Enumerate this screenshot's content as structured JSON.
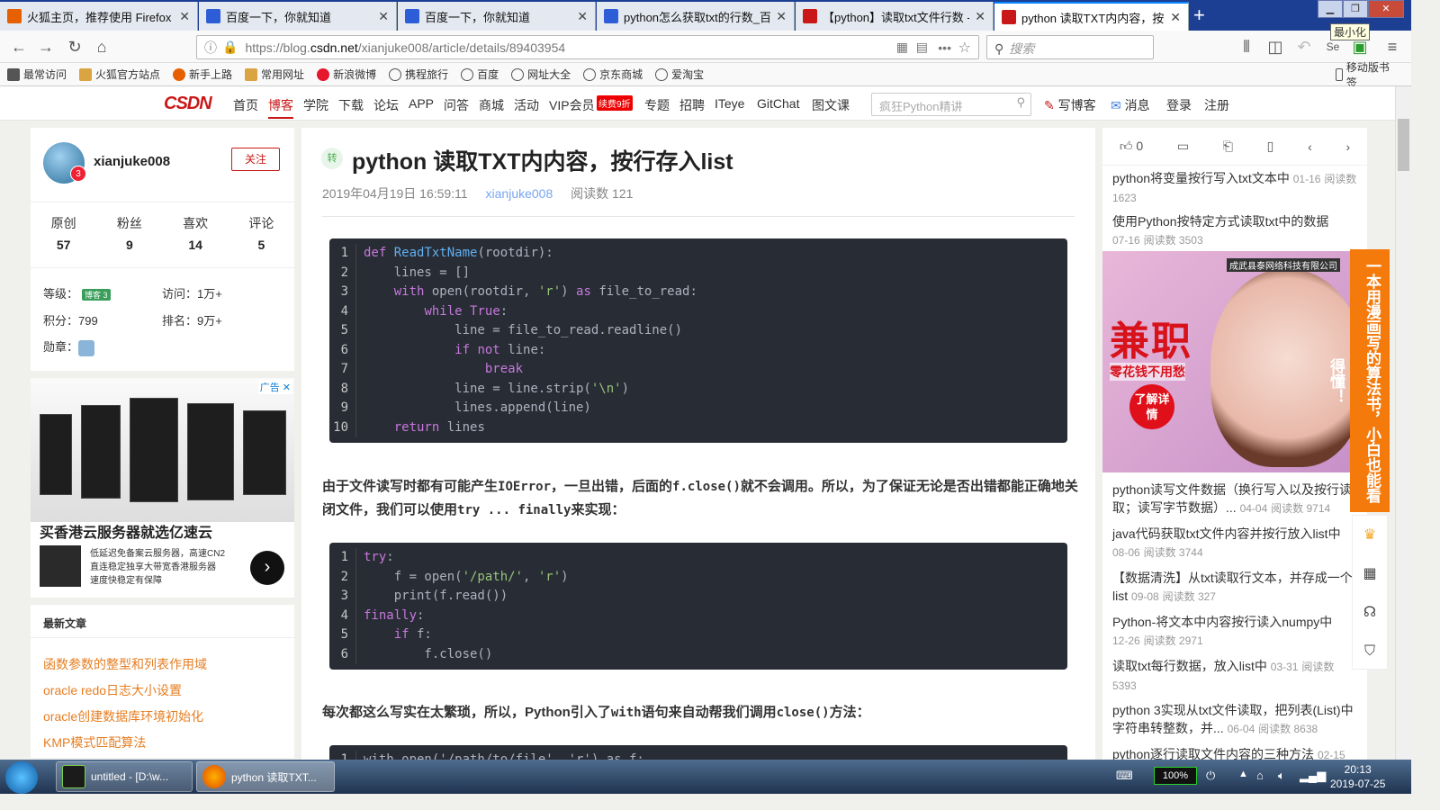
{
  "browser": {
    "tabs": [
      {
        "label": "火狐主页，推荐使用 Firefox 火狐浏",
        "icon": "firefox-icon",
        "active": false
      },
      {
        "label": "百度一下，你就知道",
        "icon": "baidu-icon",
        "active": false
      },
      {
        "label": "百度一下，你就知道",
        "icon": "baidu-icon",
        "active": false
      },
      {
        "label": "python怎么获取txt的行数_百度",
        "icon": "baidu-icon",
        "active": false
      },
      {
        "label": "【python】读取txt文件行数 -",
        "icon": "csdn-icon",
        "active": false
      },
      {
        "label": "python 读取TXT内内容，按行存",
        "icon": "csdn-icon",
        "active": true
      }
    ],
    "new_tab": "+",
    "minimize_tooltip": "最小化",
    "url_prefix": "https://blog.",
    "url_domain": "csdn.net",
    "url_path": "/xianjuke008/article/details/89403954",
    "search_placeholder": "搜索",
    "bookmarks": [
      "最常访问",
      "火狐官方站点",
      "新手上路",
      "常用网址",
      "新浪微博",
      "携程旅行",
      "百度",
      "网址大全",
      "京东商城",
      "爱淘宝"
    ],
    "mobile_bookmarks": "移动版书签"
  },
  "csdn": {
    "logo": "CSDN",
    "nav": [
      "首页",
      "博客",
      "学院",
      "下载",
      "论坛",
      "APP",
      "问答",
      "商城",
      "活动",
      "VIP会员",
      "专题",
      "招聘",
      "ITeye",
      "GitChat",
      "图文课"
    ],
    "active_nav": "博客",
    "vip_badge": "续费9折",
    "search_placeholder": "疯狂Python精讲",
    "write_blog": "写博客",
    "messages": "消息",
    "login": "登录",
    "register": "注册"
  },
  "profile": {
    "username": "xianjuke008",
    "level_badge": "3",
    "follow": "关注",
    "stats": [
      {
        "label": "原创",
        "value": "57"
      },
      {
        "label": "粉丝",
        "value": "9"
      },
      {
        "label": "喜欢",
        "value": "14"
      },
      {
        "label": "评论",
        "value": "5"
      }
    ],
    "level_label": "等级：",
    "level_tag": "博客 3",
    "visits_label": "访问：",
    "visits": "1万+",
    "points_label": "积分：",
    "points": "799",
    "rank_label": "排名：",
    "rank": "9万+",
    "medal_label": "勋章："
  },
  "left_ad": {
    "badge": "广告",
    "title": "买香港云服务器就选亿速云",
    "desc": [
      "低延迟免备案云服务器，高速CN2",
      "直连稳定独享大带宽香港服务器",
      "速度快稳定有保障"
    ]
  },
  "recent": {
    "heading": "最新文章",
    "items": [
      "函数参数的整型和列表作用域",
      "oracle redo日志大小设置",
      "oracle创建数据库环境初始化",
      "KMP模式匹配算法"
    ]
  },
  "article": {
    "tag": "转",
    "title": "python 读取TXT内内容，按行存入list",
    "date": "2019年04月19日 16:59:11",
    "author": "xianjuke008",
    "reads": "阅读数 121",
    "code1": [
      "def ReadTxtName(rootdir):",
      "    lines = []",
      "    with open(rootdir, 'r') as file_to_read:",
      "        while True:",
      "            line = file_to_read.readline()",
      "            if not line:",
      "                break",
      "            line = line.strip('\\n')",
      "            lines.append(line)",
      "    return lines"
    ],
    "para1": "由于文件读写时都有可能产生IOError，一旦出错，后面的f.close()就不会调用。所以，为了保证无论是否出错都能正确地关闭文件，我们可以使用try ... finally来实现：",
    "code2": [
      "try:",
      "    f = open('/path/', 'r')",
      "    print(f.read())",
      "finally:",
      "    if f:",
      "        f.close()"
    ],
    "para2": "每次都这么写实在太繁琐，所以，Python引入了with语句来自动帮我们调用close()方法：",
    "code3_partial": "with open('/path/to/file', 'r') as f:"
  },
  "right": {
    "like_count": "0",
    "items": [
      {
        "title": "python将变量按行写入txt文本中",
        "date": "01-16",
        "reads": "阅读数 1623"
      },
      {
        "title": "使用Python按特定方式读取txt中的数据",
        "date": "07-16",
        "reads": "阅读数 3503"
      },
      {
        "title": "python读写文件数据（换行写入以及按行读取；读写字节数据）...",
        "date": "04-04",
        "reads": "阅读数 9714"
      },
      {
        "title": "java代码获取txt文件内容并按行放入list中",
        "date": "08-06",
        "reads": "阅读数 3744"
      },
      {
        "title": "【数据清洗】从txt读取行文本，并存成一个list",
        "date": "09-08",
        "reads": "阅读数 327"
      },
      {
        "title": "Python-将文本中内容按行读入numpy中",
        "date": "12-26",
        "reads": "阅读数 2971"
      },
      {
        "title": "读取txt每行数据，放入list中",
        "date": "03-31",
        "reads": "阅读数 5393"
      },
      {
        "title": "python 3实现从txt文件读取，把列表(List)中字符串转整数，并...",
        "date": "06-04",
        "reads": "阅读数 8638"
      },
      {
        "title": "python逐行读取文件内容的三种方法",
        "date": "02-15",
        "reads": ""
      }
    ],
    "ad_company": "成武县泰网络科技有限公司",
    "ad_big": "兼职",
    "ad_sub": "零花钱不用愁",
    "ad_btn": "了解详情"
  },
  "float_banner": "一本用漫画写的算法书，小白也能看得懂！",
  "taskbar": {
    "items": [
      {
        "label": "untitled - [D:\\w...",
        "icon": "pycharm-icon"
      },
      {
        "label": "python 读取TXT...",
        "icon": "firefox-icon"
      }
    ],
    "battery": "100%",
    "time": "20:13",
    "date": "2019-07-25"
  }
}
